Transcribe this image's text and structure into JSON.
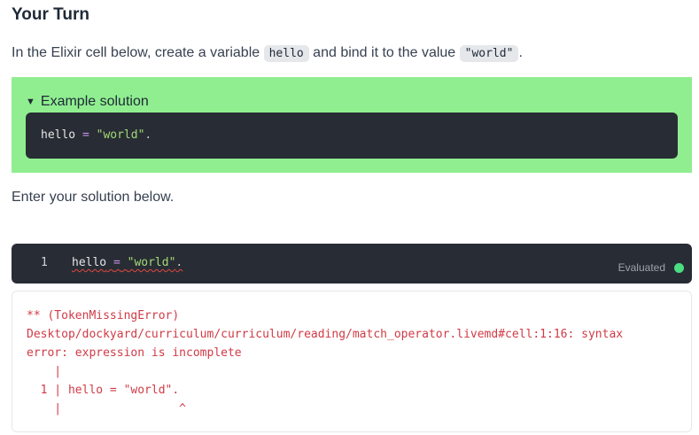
{
  "heading": "Your Turn",
  "instruction": {
    "before": "In the Elixir cell below, create a variable ",
    "code1": "hello",
    "middle": " and bind it to the value ",
    "code2": "\"world\"",
    "after": "."
  },
  "example": {
    "summary_label": "Example solution",
    "code": {
      "identifier": "hello",
      "operator": "=",
      "string": "\"world\"",
      "punct": "."
    },
    "background": "#90ee90"
  },
  "prompt": "Enter your solution below.",
  "editor": {
    "line_number": "1",
    "code": "hello = \"world\".",
    "status": "Evaluated",
    "status_color": "#4ade80"
  },
  "error": {
    "lines": [
      "** (TokenMissingError)",
      "Desktop/dockyard/curriculum/curriculum/reading/match_operator.livemd#cell:1:16: syntax",
      "error: expression is incomplete",
      "    |",
      "  1 | hello = \"world\".",
      "    |                 ^"
    ],
    "color": "#d03a46"
  }
}
